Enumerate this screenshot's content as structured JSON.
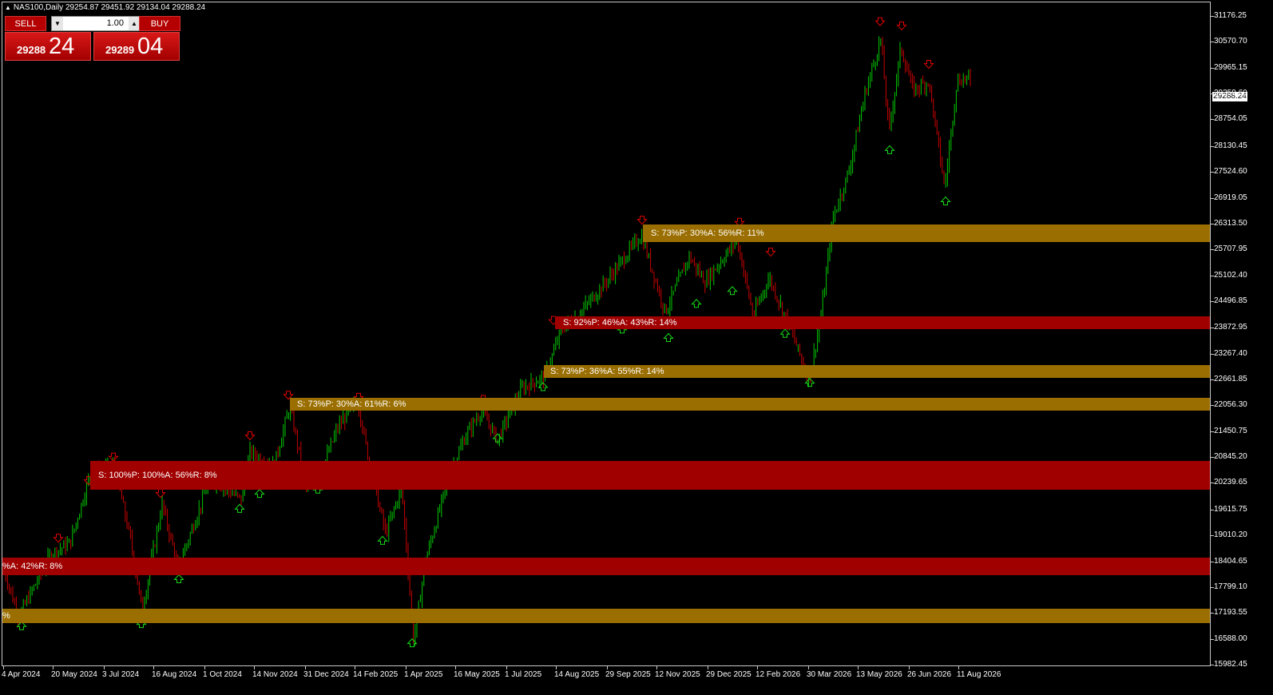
{
  "chart": {
    "symbol_title": "NAS100,Daily  29254.87 29451.92 29134.04 29288.24",
    "current_price": "29288.24"
  },
  "trade_panel": {
    "sell_label": "SELL",
    "buy_label": "BUY",
    "lot_value": "1.00",
    "sell_small": "29288",
    "sell_big": "24",
    "buy_small": "29289",
    "buy_big": "04"
  },
  "price_axis": [
    "31176.25",
    "30570.70",
    "29965.15",
    "29359.60",
    "28754.05",
    "28130.45",
    "27524.60",
    "26919.05",
    "26313.50",
    "25707.95",
    "25102.40",
    "24496.85",
    "23872.95",
    "23267.40",
    "22661.85",
    "22056.30",
    "21450.75",
    "20845.20",
    "20239.65",
    "19615.75",
    "19010.20",
    "18404.65",
    "17799.10",
    "17193.55",
    "16588.00",
    "15982.45"
  ],
  "date_axis": [
    "4 Apr 2024",
    "20 May 2024",
    "3 Jul 2024",
    "16 Aug 2024",
    "1 Oct 2024",
    "14 Nov 2024",
    "31 Dec 2024",
    "14 Feb 2025",
    "1 Apr 2025",
    "16 May 2025",
    "1 Jul 2025",
    "14 Aug 2025",
    "29 Sep 2025",
    "12 Nov 2025",
    "29 Dec 2025",
    "12 Feb 2026",
    "30 Mar 2026",
    "13 May 2026",
    "26 Jun 2026",
    "11 Aug 2026"
  ],
  "zones": [
    {
      "label": "S: 73%P: 30%A: 56%R: 11%",
      "color": "#9a6e00",
      "price": 26100
    },
    {
      "label": "S: 92%P: 46%A: 43%R: 14%",
      "color": "#a00000",
      "price": 24010
    },
    {
      "label": "S: 73%P: 36%A: 55%R: 14%",
      "color": "#9a6e00",
      "price": 22870
    },
    {
      "label": "S: 73%P: 30%A: 61%R: 6%",
      "color": "#9a6e00",
      "price": 22110
    },
    {
      "label": "S: 100%P: 100%A: 56%R: 8%",
      "color": "#a00000",
      "price": 20430
    },
    {
      "label": "%A: 42%R: 8%",
      "color": "#a00000",
      "price": 18300
    },
    {
      "label": "%",
      "color": "#9a6e00",
      "price": 17150
    }
  ],
  "colors": {
    "up_candle": "#00c800",
    "down_candle": "#c80000",
    "background": "#000000",
    "grid_axis": "#c8c8c8"
  },
  "icons": {
    "sell_arrow": "arrow-down-icon",
    "buy_arrow": "arrow-up-icon",
    "lot_down": "triangle-down-icon",
    "lot_up": "triangle-up-icon"
  }
}
